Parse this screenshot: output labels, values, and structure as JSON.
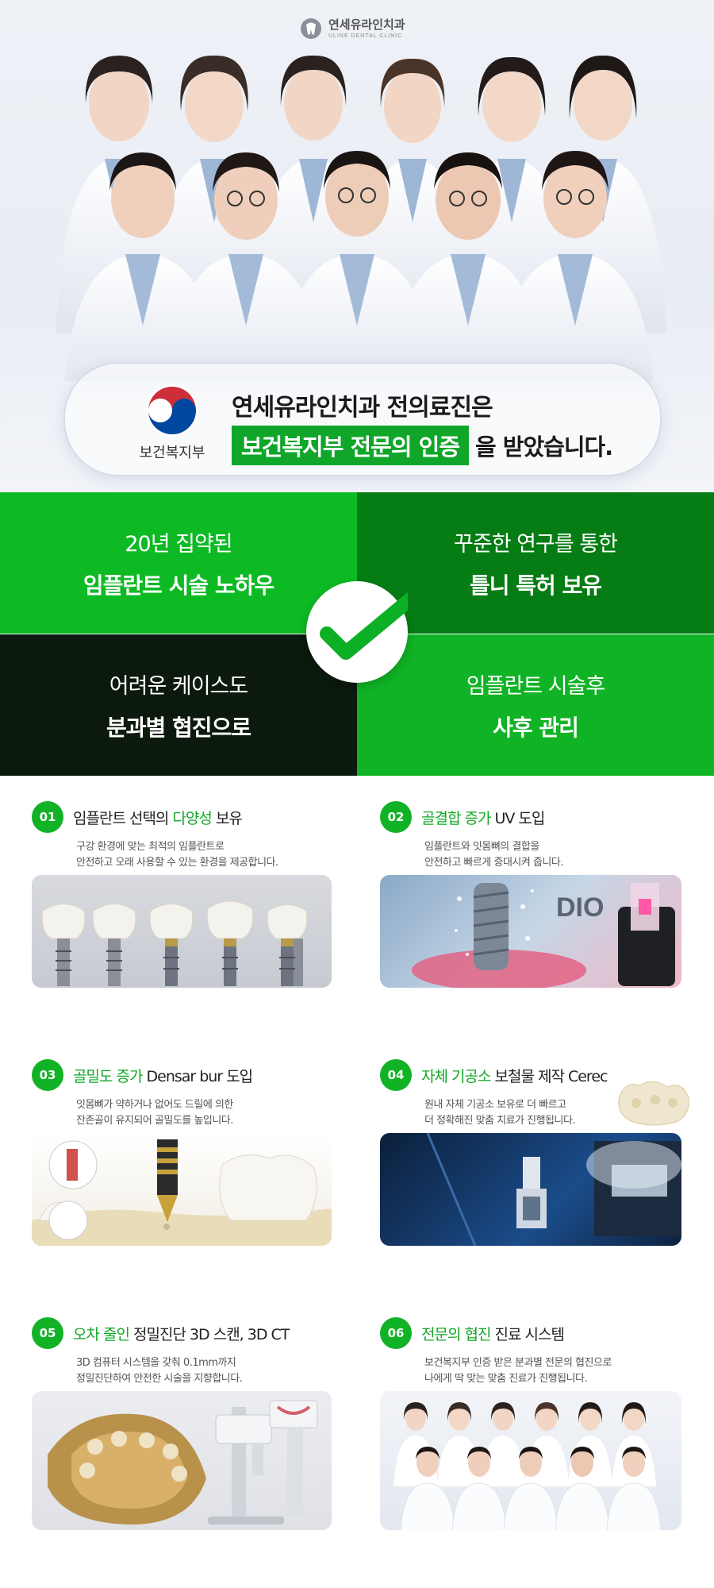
{
  "header": {
    "logo_ko": "연세유라인치과",
    "logo_en": "ULINE DENTAL CLINIC"
  },
  "certification": {
    "org_name": "보건복지부",
    "line1": "연세유라인치과 전의료진은",
    "badge": "보건복지부 전문의 인증",
    "tail": "을 받았습니다."
  },
  "grid": [
    {
      "top": "20년 집약된",
      "bottom": "임플란트 시술 노하우"
    },
    {
      "top": "꾸준한 연구를 통한",
      "bottom": "틀니 특허 보유"
    },
    {
      "top": "어려운 케이스도",
      "bottom": "분과별 협진으로"
    },
    {
      "top": "임플란트 시술후",
      "bottom": "사후 관리"
    }
  ],
  "features": [
    {
      "num": "01",
      "title_pre": "임플란트 선택의 ",
      "title_hl": "다양성",
      "title_post": " 보유",
      "desc1": "구강 환경에 맞는 최적의 임플란트로",
      "desc2": "안전하고 오래 사용할 수 있는 환경을 제공합니다."
    },
    {
      "num": "02",
      "title_pre": "",
      "title_hl": "골결합 증가",
      "title_post": " UV 도입",
      "desc1": "임플란트와 잇몸뼈의 결합을",
      "desc2": "안전하고 빠르게 증대시켜 줍니다.",
      "brand": "DIO"
    },
    {
      "num": "03",
      "title_pre": "",
      "title_hl": "골밀도 증가",
      "title_post": " Densar bur 도입",
      "desc1": "잇몸뼈가 약하거나 없어도 드릴에 의한",
      "desc2": "잔존골이 유지되어 골밀도를 높입니다."
    },
    {
      "num": "04",
      "title_pre": "",
      "title_hl": "자체 기공소",
      "title_post": " 보철물 제작 Cerec",
      "desc1": "원내 자체 기공소 보유로 더 빠르고",
      "desc2": "더 정확해진 맞춤 치료가 진행됩니다."
    },
    {
      "num": "05",
      "title_pre": "",
      "title_hl": "오차 줄인",
      "title_post": " 정밀진단 3D 스캔, 3D CT",
      "desc1": "3D 컴퓨터 시스템을 갖춰 0.1mm까지",
      "desc2": "정밀진단하여 안전한 시술을 지향합니다."
    },
    {
      "num": "06",
      "title_pre": "",
      "title_hl": "전문의 협진",
      "title_post": " 진료 시스템",
      "desc1": "보건복지부 인증 받은 분과별 전문의 협진으로",
      "desc2": "나에게 딱 맞는 맞춤 진료가 진행됩니다."
    }
  ],
  "colors": {
    "brand_green": "#12b226",
    "dark_green": "#067d14",
    "dark": "#0b1a0c"
  }
}
